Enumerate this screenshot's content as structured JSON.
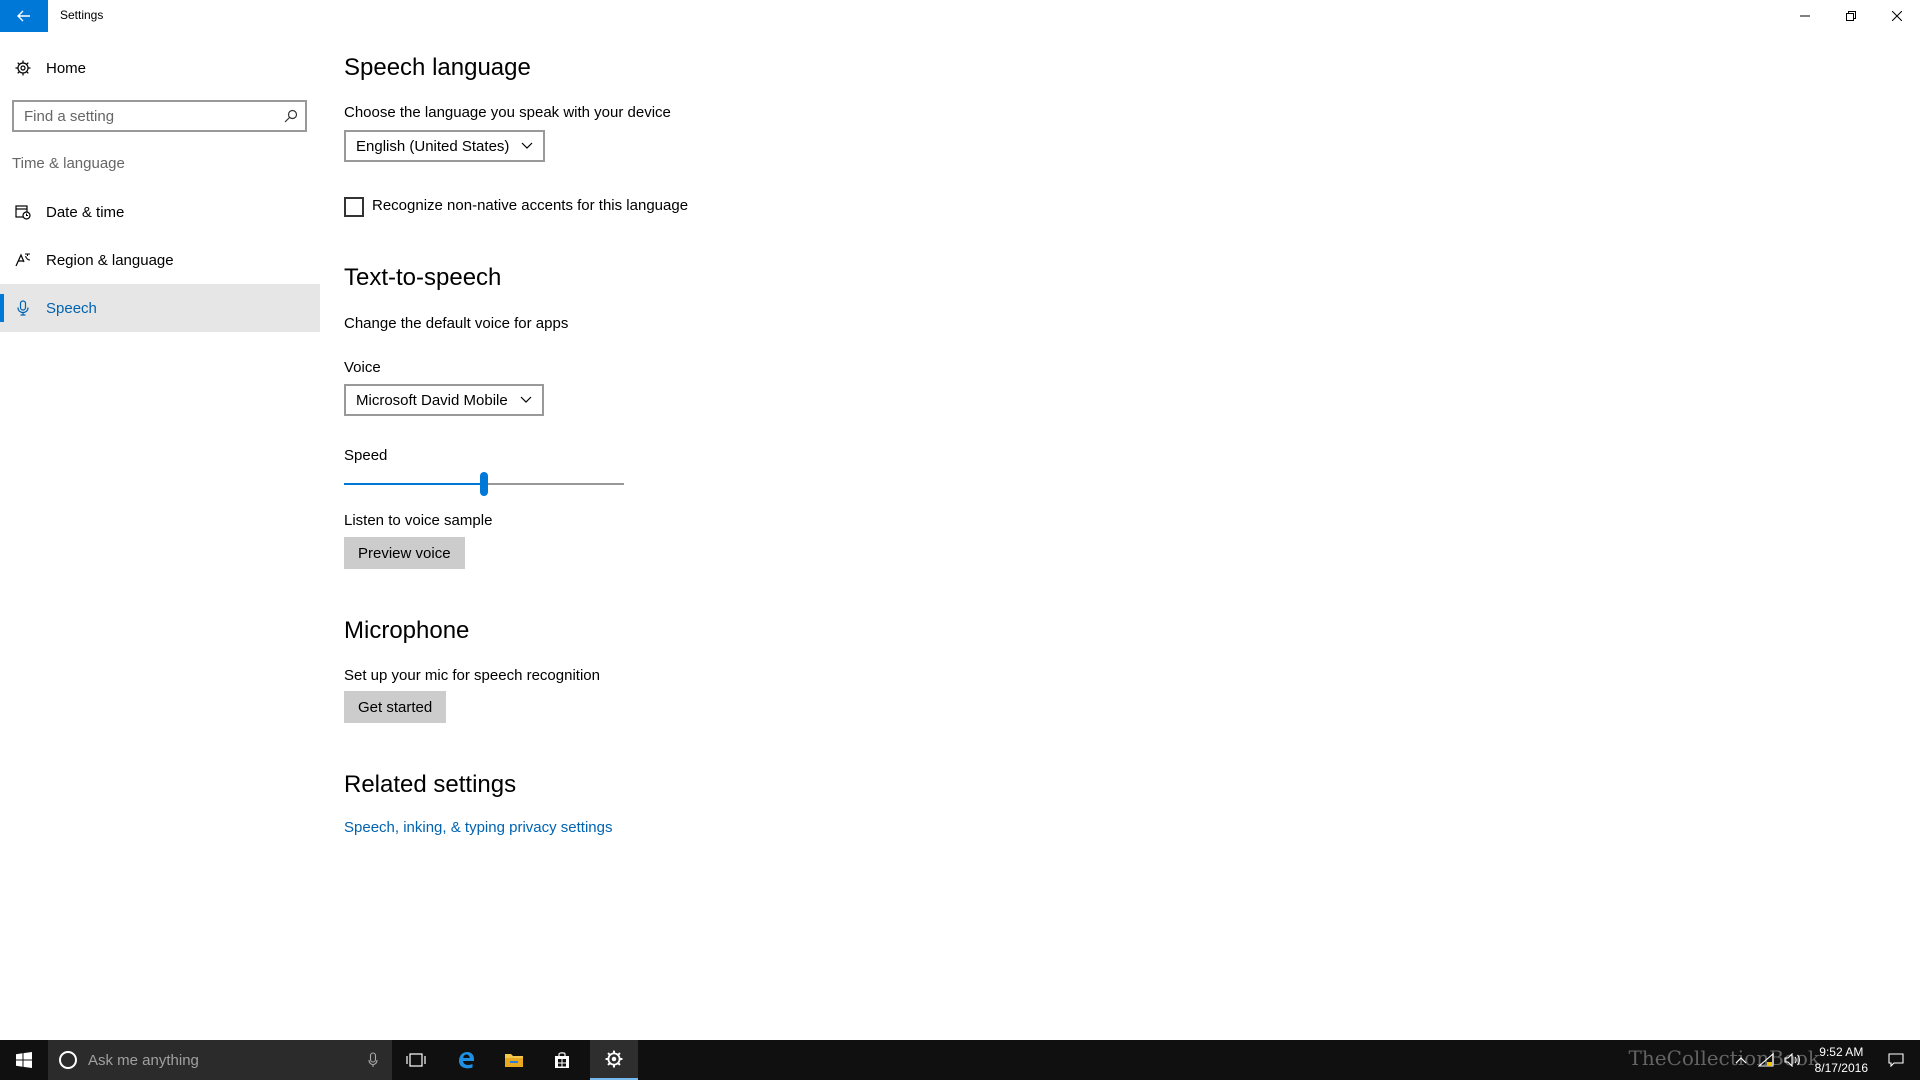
{
  "window": {
    "title": "Settings"
  },
  "sidebar": {
    "home_label": "Home",
    "search_placeholder": "Find a setting",
    "group_label": "Time & language",
    "items": [
      {
        "label": "Date & time",
        "icon": "calendar-clock-icon"
      },
      {
        "label": "Region & language",
        "icon": "region-language-icon"
      },
      {
        "label": "Speech",
        "icon": "microphone-icon",
        "active": true
      }
    ]
  },
  "speech_language": {
    "heading": "Speech language",
    "description": "Choose the language you speak with your device",
    "selected_language": "English (United States)",
    "accent_checkbox_label": "Recognize non-native accents for this language",
    "accent_checked": false
  },
  "tts": {
    "heading": "Text-to-speech",
    "description": "Change the default voice for apps",
    "voice_label": "Voice",
    "selected_voice": "Microsoft David Mobile",
    "speed_label": "Speed",
    "speed_fraction": 0.5,
    "sample_label": "Listen to voice sample",
    "preview_button": "Preview voice"
  },
  "microphone": {
    "heading": "Microphone",
    "description": "Set up your mic for speech recognition",
    "button": "Get started"
  },
  "related": {
    "heading": "Related settings",
    "link": "Speech, inking, & typing privacy settings"
  },
  "taskbar": {
    "search_placeholder": "Ask me anything",
    "time": "9:52 AM",
    "date": "8/17/2016",
    "watermark": "TheCollectionBook"
  },
  "colors": {
    "accent": "#0078d7",
    "link": "#0063b1",
    "taskbar": "#101010"
  }
}
